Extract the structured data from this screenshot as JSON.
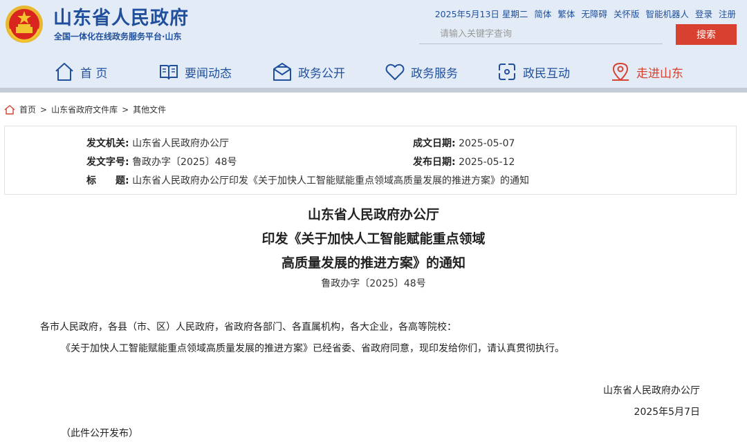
{
  "header": {
    "site_title": "山东省人民政府",
    "site_subtitle": "全国一体化在线政务服务平台·山东",
    "date": "2025年5月13日 星期二",
    "links": [
      "简体",
      "繁体",
      "无障碍",
      "关怀版",
      "智能机器人",
      "登录",
      "注册"
    ],
    "search_placeholder": "请输入关键字查询",
    "search_button": "搜索",
    "colors": {
      "brand_blue": "#1f4f9d",
      "accent_red": "#d8412f",
      "header_bg": "#e3ecf6"
    }
  },
  "nav": [
    {
      "label": "首 页",
      "icon": "home-icon"
    },
    {
      "label": "要闻动态",
      "icon": "book-icon"
    },
    {
      "label": "政务公开",
      "icon": "mail-icon"
    },
    {
      "label": "政务服务",
      "icon": "heart-icon"
    },
    {
      "label": "政民互动",
      "icon": "interaction-icon"
    },
    {
      "label": "走进山东",
      "icon": "location-icon"
    }
  ],
  "breadcrumb": [
    "首页",
    "山东省政府文件库",
    "其他文件"
  ],
  "meta": {
    "issuer_label": "发文机关:",
    "issuer": "山东省人民政府办公厅",
    "doc_no_label": "发文字号:",
    "doc_no": "鲁政办字〔2025〕48号",
    "title_label": "标　　题:",
    "title": "山东省人民政府办公厅印发《关于加快人工智能赋能重点领域高质量发展的推进方案》的通知",
    "written_label": "成文日期:",
    "written_date": "2025-05-07",
    "published_label": "发布日期:",
    "published_date": "2025-05-12"
  },
  "document": {
    "title_lines": [
      "山东省人民政府办公厅",
      "印发《关于加快人工智能赋能重点领域",
      "高质量发展的推进方案》的通知"
    ],
    "number": "鲁政办字〔2025〕48号",
    "addressee": "各市人民政府，各县（市、区）人民政府，省政府各部门、各直属机构，各大企业，各高等院校：",
    "body": "《关于加快人工智能赋能重点领域高质量发展的推进方案》已经省委、省政府同意，现印发给你们，请认真贯彻执行。",
    "signature": "山东省人民政府办公厅",
    "sign_date": "2025年5月7日",
    "note": "（此件公开发布）"
  }
}
